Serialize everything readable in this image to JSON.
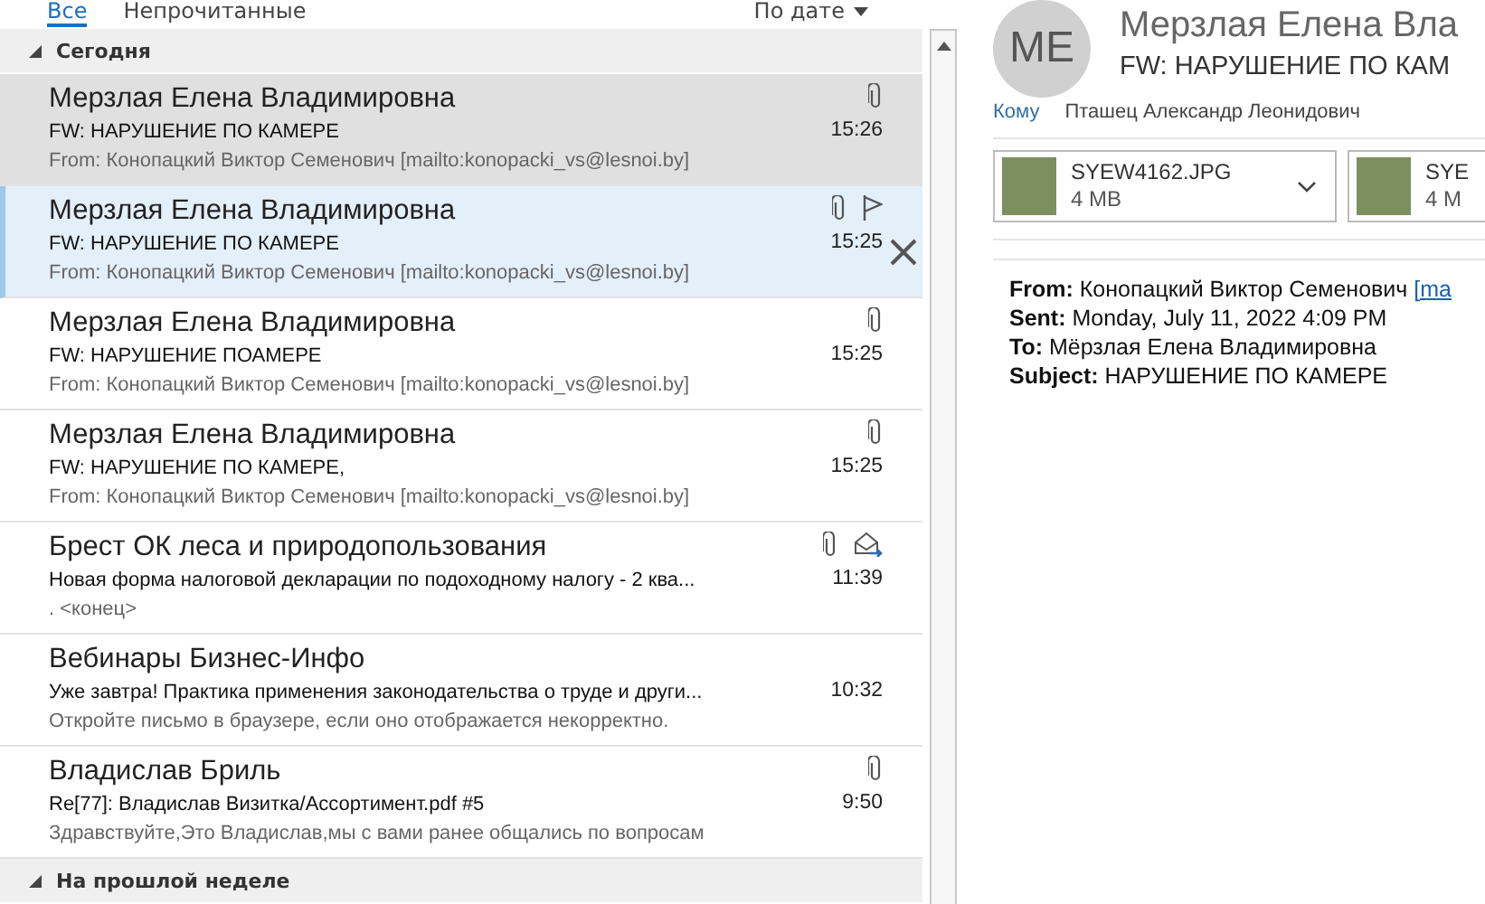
{
  "tabs": [
    {
      "label": "Все",
      "selected": true
    },
    {
      "label": "Непрочитанные",
      "selected": false
    }
  ],
  "sort": {
    "label": "По дате"
  },
  "groups": [
    {
      "label": "Сегодня",
      "expanded": true,
      "messages": [
        {
          "sender": "Мерзлая Елена Владимировна",
          "subject": "FW: НАРУШЕНИЕ ПО КАМЕРЕ",
          "preview": "From: Конопацкий Виктор Семенович [mailto:konopacki_vs@lesnoi.by]",
          "time": "15:26",
          "attachment": true,
          "flag": false,
          "forwarded": false,
          "selected": false,
          "highlighted": true
        },
        {
          "sender": "Мерзлая Елена Владимировна",
          "subject": "FW: НАРУШЕНИЕ ПО КАМЕРЕ",
          "preview": "From: Конопацкий Виктор Семенович [mailto:konopacki_vs@lesnoi.by]",
          "time": "15:25",
          "attachment": true,
          "flag": true,
          "forwarded": false,
          "selected": true,
          "highlighted": false
        },
        {
          "sender": "Мерзлая Елена Владимировна",
          "subject": "FW: НАРУШЕНИЕ ПОАМЕРЕ",
          "preview": "From: Конопацкий Виктор Семенович [mailto:konopacki_vs@lesnoi.by]",
          "time": "15:25",
          "attachment": true,
          "flag": false,
          "forwarded": false,
          "selected": false,
          "highlighted": false
        },
        {
          "sender": "Мерзлая Елена Владимировна",
          "subject": "FW: НАРУШЕНИЕ ПО КАМЕРЕ,",
          "preview": "From: Конопацкий Виктор Семенович [mailto:konopacki_vs@lesnoi.by]",
          "time": "15:25",
          "attachment": true,
          "flag": false,
          "forwarded": false,
          "selected": false,
          "highlighted": false
        },
        {
          "sender": "Брест ОК леса  и природопользования",
          "subject": "Новая форма налоговой декларации по подоходному налогу - 2 ква...",
          "preview": ". <конец>",
          "time": "11:39",
          "attachment": true,
          "flag": false,
          "forwarded": true,
          "selected": false,
          "highlighted": false
        },
        {
          "sender": "Вебинары Бизнес-Инфо",
          "subject": "Уже завтра! Практика применения законодательства о труде и други...",
          "preview": "Откройте письмо в браузере, если оно отображается некорректно.",
          "time": "10:32",
          "attachment": false,
          "flag": false,
          "forwarded": false,
          "selected": false,
          "highlighted": false
        },
        {
          "sender": "Владислав Бриль",
          "subject": "Re[77]: Владислав Визитка/Ассортимент.pdf #5",
          "preview": "Здравствуйте,Это Владислав,мы с вами ранее общались по вопросам",
          "time": "9:50",
          "attachment": true,
          "flag": false,
          "forwarded": false,
          "selected": false,
          "highlighted": false
        }
      ]
    },
    {
      "label": "На прошлой неделе",
      "expanded": true
    }
  ],
  "reading": {
    "initials": "ME",
    "sender": "Мерзлая Елена Вла",
    "subject": "FW: НАРУШЕНИЕ ПО КАМ",
    "to_label": "Кому",
    "to": "Пташец Александр Леонидович",
    "attachments": [
      {
        "name": "SYEW4162.JPG",
        "size": "4 MB"
      },
      {
        "name": "SYE",
        "size": "4 M"
      }
    ],
    "header_lines": [
      {
        "label": "From:",
        "value": "Конопацкий Виктор Семенович ",
        "link": "[ma"
      },
      {
        "label": "Sent:",
        "value": "Monday, July 11, 2022 4:09 PM"
      },
      {
        "label": "To:",
        "value": "Мёрзлая Елена Владимировна"
      },
      {
        "label": "Subject:",
        "value": "НАРУШЕНИЕ ПО КАМЕРЕ"
      }
    ]
  }
}
